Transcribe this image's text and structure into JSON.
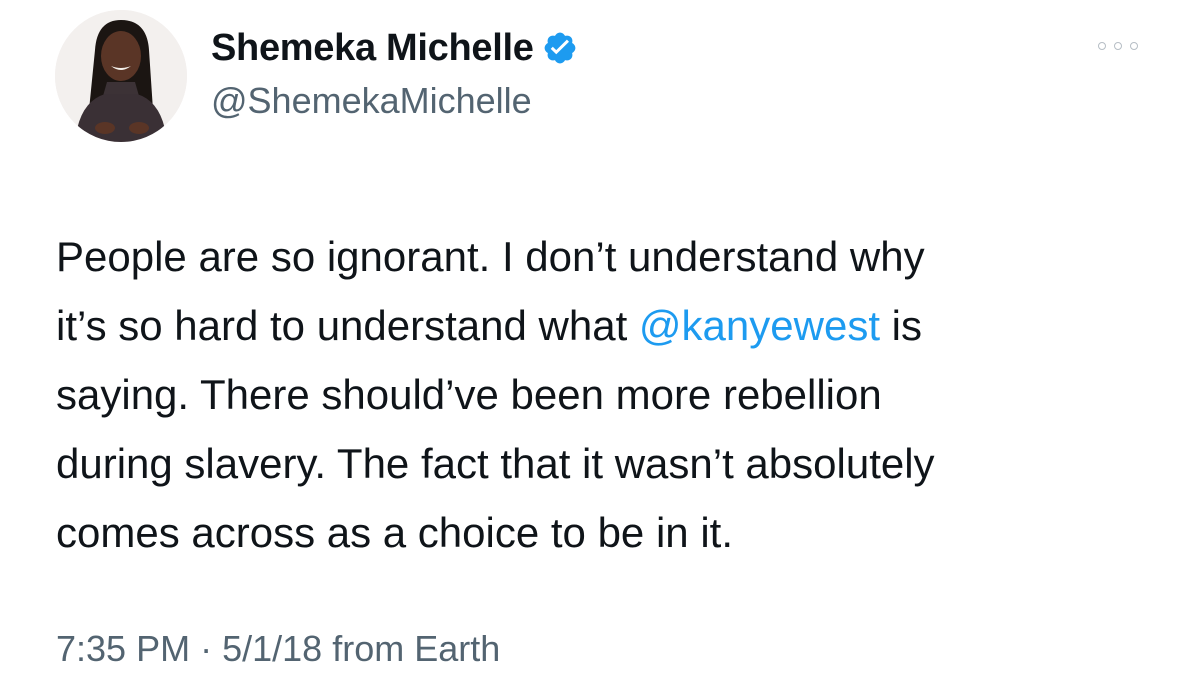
{
  "author": {
    "display_name": "Shemeka Michelle",
    "handle": "@ShemekaMichelle",
    "verified": true
  },
  "tweet": {
    "lines": [
      {
        "before": "People are so ignorant. I don’t understand why",
        "mention": "",
        "after": ""
      },
      {
        "before": "it’s so hard to understand what ",
        "mention": "@kanyewest",
        "after": " is"
      },
      {
        "before": "saying. There should’ve been more rebellion",
        "mention": "",
        "after": ""
      },
      {
        "before": "during slavery. The fact that it wasn’t absolutely",
        "mention": "",
        "after": ""
      },
      {
        "before": "comes across as a choice to be in it.",
        "mention": "",
        "after": ""
      }
    ]
  },
  "meta": {
    "time": "7:35 PM",
    "separator": "·",
    "date": "5/1/18",
    "source": "from Earth"
  },
  "colors": {
    "mention": "#1d9bf0",
    "secondary_text": "#536471",
    "verified_badge": "#1d9bf0"
  },
  "icons": {
    "verified": "verified-badge-icon",
    "more": "more-options-icon"
  }
}
